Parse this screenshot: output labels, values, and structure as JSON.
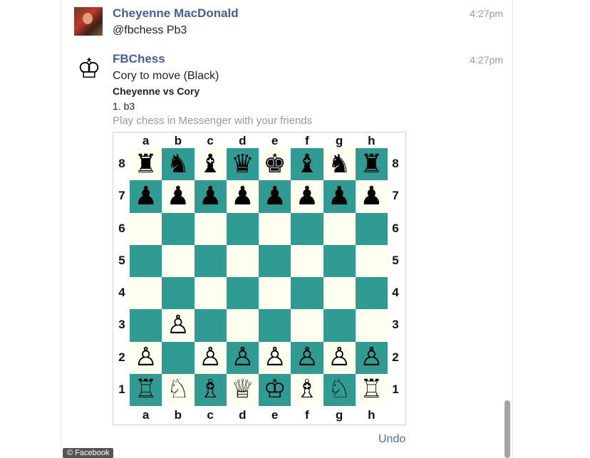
{
  "messages": [
    {
      "sender": "Cheyenne MacDonald",
      "time": "4:27pm",
      "text": "@fbchess Pb3"
    },
    {
      "sender": "FBChess",
      "time": "4:27pm",
      "lines": [
        "Cory to move (Black)",
        "Cheyenne vs Cory",
        "1. b3",
        "Play chess in Messenger with your friends"
      ]
    }
  ],
  "board": {
    "files": [
      "a",
      "b",
      "c",
      "d",
      "e",
      "f",
      "g",
      "h"
    ],
    "ranks": [
      "8",
      "7",
      "6",
      "5",
      "4",
      "3",
      "2",
      "1"
    ],
    "rows": [
      [
        "♜",
        "♞",
        "♝",
        "♛",
        "♚",
        "♝",
        "♞",
        "♜"
      ],
      [
        "♟",
        "♟",
        "♟",
        "♟",
        "♟",
        "♟",
        "♟",
        "♟"
      ],
      [
        "",
        "",
        "",
        "",
        "",
        "",
        "",
        ""
      ],
      [
        "",
        "",
        "",
        "",
        "",
        "",
        "",
        ""
      ],
      [
        "",
        "",
        "",
        "",
        "",
        "",
        "",
        ""
      ],
      [
        "",
        "♙",
        "",
        "",
        "",
        "",
        "",
        ""
      ],
      [
        "♙",
        "",
        "♙",
        "♙",
        "♙",
        "♙",
        "♙",
        "♙"
      ],
      [
        "♖",
        "♘",
        "♗",
        "♕",
        "♔",
        "♗",
        "♘",
        "♖"
      ]
    ],
    "colors": {
      "light": "#fffff0",
      "dark": "#2f9b92"
    }
  },
  "undo_label": "Undo",
  "credit": "© Facebook",
  "accent": "#4060a0",
  "bot_icon": "♔"
}
